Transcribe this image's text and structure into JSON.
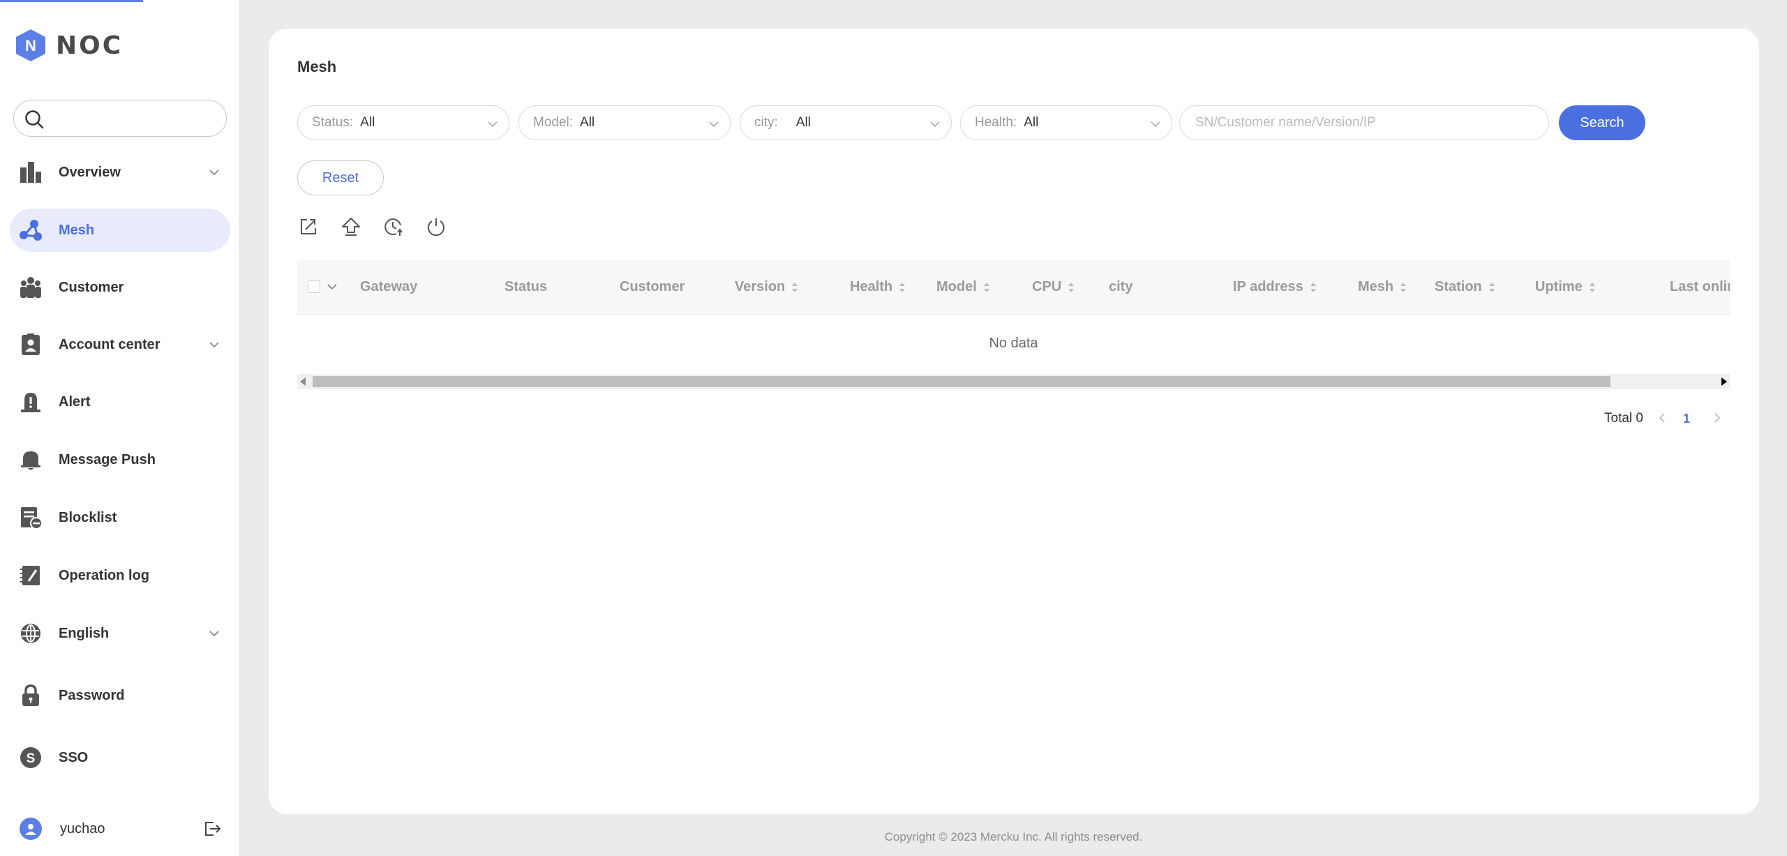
{
  "brand": {
    "logo_letter": "N",
    "name": "NOC",
    "accent_color": "#5b7fe6"
  },
  "sidebar": {
    "search": {
      "placeholder": "",
      "value": ""
    },
    "items": [
      {
        "label": "Overview",
        "icon": "chart-bars-icon",
        "has_submenu": true,
        "active": false
      },
      {
        "label": "Mesh",
        "icon": "mesh-nodes-icon",
        "has_submenu": false,
        "active": true
      },
      {
        "label": "Customer",
        "icon": "people-icon",
        "has_submenu": false,
        "active": false
      },
      {
        "label": "Account center",
        "icon": "id-card-icon",
        "has_submenu": true,
        "active": false
      },
      {
        "label": "Alert",
        "icon": "alarm-light-icon",
        "has_submenu": false,
        "active": false
      },
      {
        "label": "Message Push",
        "icon": "bell-icon",
        "has_submenu": false,
        "active": false
      },
      {
        "label": "Blocklist",
        "icon": "blocklist-icon",
        "has_submenu": false,
        "active": false
      },
      {
        "label": "Operation log",
        "icon": "log-book-icon",
        "has_submenu": false,
        "active": false
      },
      {
        "label": "English",
        "icon": "globe-icon",
        "has_submenu": true,
        "active": false
      },
      {
        "label": "Password",
        "icon": "lock-icon",
        "has_submenu": false,
        "active": false
      },
      {
        "label": "SSO",
        "icon": "sso-badge-icon",
        "has_submenu": false,
        "active": false
      }
    ],
    "user": {
      "name": "yuchao",
      "icon": "user-avatar-icon",
      "logout_icon": "logout-icon"
    }
  },
  "page": {
    "title": "Mesh",
    "filters": {
      "status": {
        "label": "Status:",
        "value": "All"
      },
      "model": {
        "label": "Model:",
        "value": "All"
      },
      "city": {
        "label": "city:",
        "value": "All"
      },
      "health": {
        "label": "Health:",
        "value": "All"
      }
    },
    "keyword": {
      "placeholder": "SN/Customer name/Version/IP",
      "value": ""
    },
    "search_label": "Search",
    "reset_label": "Reset",
    "toolbar_icons": [
      "export-icon",
      "upgrade-icon",
      "schedule-icon",
      "power-icon"
    ],
    "table": {
      "columns": [
        {
          "label": "Gateway",
          "sortable": false
        },
        {
          "label": "Status",
          "sortable": false
        },
        {
          "label": "Customer",
          "sortable": false
        },
        {
          "label": "Version",
          "sortable": true
        },
        {
          "label": "Health",
          "sortable": true
        },
        {
          "label": "Model",
          "sortable": true
        },
        {
          "label": "CPU",
          "sortable": true
        },
        {
          "label": "city",
          "sortable": false
        },
        {
          "label": "IP address",
          "sortable": true
        },
        {
          "label": "Mesh",
          "sortable": true
        },
        {
          "label": "Station",
          "sortable": true
        },
        {
          "label": "Uptime",
          "sortable": true
        },
        {
          "label": "Last onlin",
          "sortable": false
        }
      ],
      "rows": [],
      "empty_text": "No data"
    },
    "pagination": {
      "total_text": "Total 0",
      "current_page": "1"
    }
  },
  "footer": {
    "copyright": "Copyright © 2023 Mercku Inc. All rights reserved."
  }
}
